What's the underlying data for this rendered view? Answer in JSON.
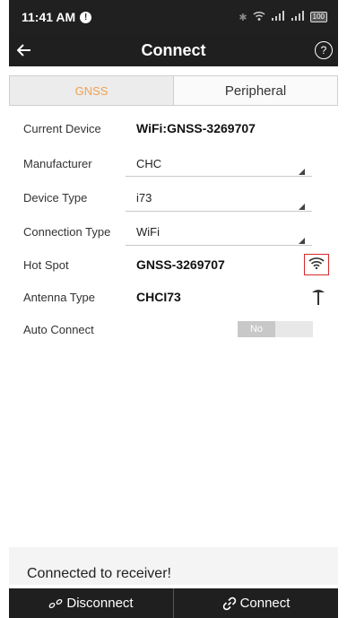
{
  "status_bar": {
    "time": "11:41 AM",
    "alert_badge": "!",
    "battery": "100"
  },
  "nav": {
    "back_icon": "arrow-left-icon",
    "title": "Connect",
    "help_label": "?"
  },
  "tabs": [
    {
      "label": "GNSS",
      "active": true
    },
    {
      "label": "Peripheral",
      "active": false
    }
  ],
  "fields": {
    "current_device": {
      "label": "Current Device",
      "value": "WiFi:GNSS-3269707"
    },
    "manufacturer": {
      "label": "Manufacturer",
      "value": "CHC"
    },
    "device_type": {
      "label": "Device Type",
      "value": "i73"
    },
    "connection_type": {
      "label": "Connection Type",
      "value": "WiFi"
    },
    "hot_spot": {
      "label": "Hot Spot",
      "value": "GNSS-3269707",
      "icon": "wifi-icon"
    },
    "antenna_type": {
      "label": "Antenna Type",
      "value": "CHCI73",
      "icon": "antenna-icon"
    },
    "auto_connect": {
      "label": "Auto Connect",
      "value": "No"
    }
  },
  "status_message": "Connected to receiver!",
  "actions": {
    "disconnect_label": "Disconnect",
    "connect_label": "Connect"
  },
  "colors": {
    "accent": "#f0a050",
    "bar": "#1f1f1f",
    "highlight": "#d62b2b"
  }
}
